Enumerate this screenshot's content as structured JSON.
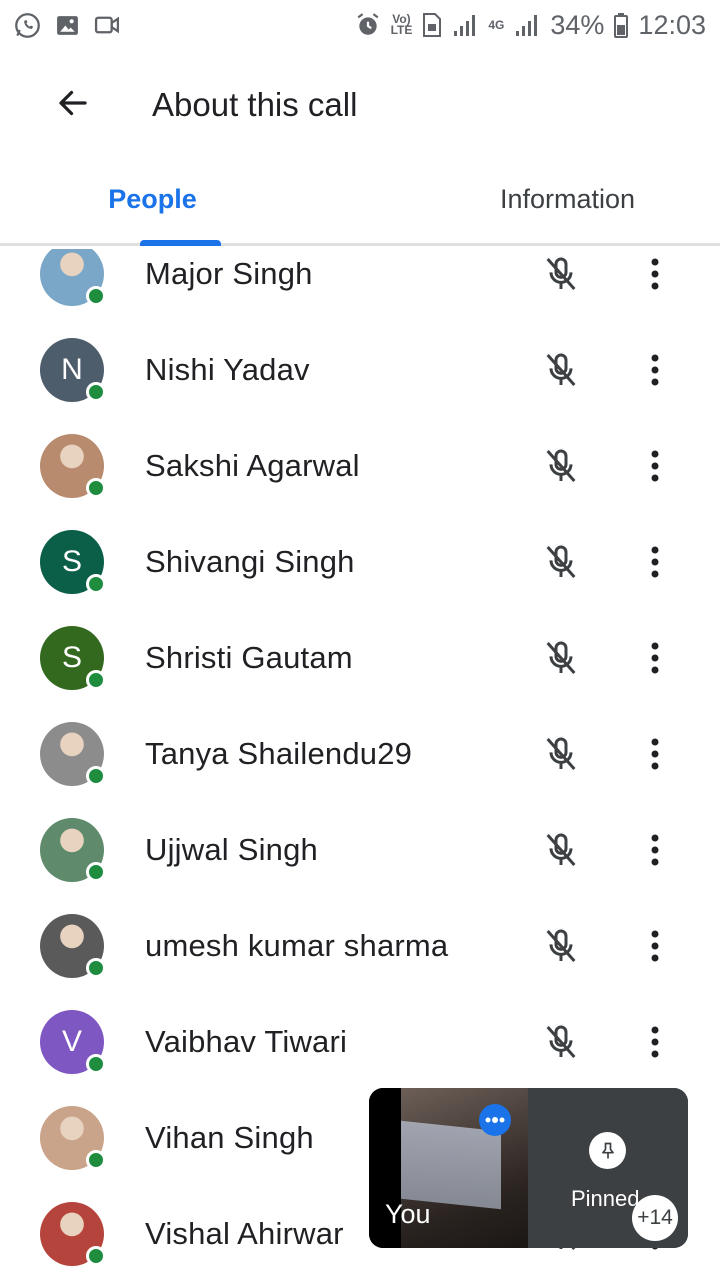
{
  "status_bar": {
    "battery": "34%",
    "time": "12:03",
    "network_top": "Vo)",
    "network_bottom": "LTE",
    "net_type": "4G"
  },
  "header": {
    "title": "About this call"
  },
  "tabs": [
    {
      "label": "People",
      "active": true
    },
    {
      "label": "Information",
      "active": false
    }
  ],
  "participants": [
    {
      "name": "Major Singh",
      "avatar_type": "photo",
      "avatar_color": "#7aa7c7"
    },
    {
      "name": "Nishi Yadav",
      "avatar_type": "letter",
      "initial": "N",
      "avatar_color": "#4e5d6c"
    },
    {
      "name": "Sakshi Agarwal",
      "avatar_type": "photo",
      "avatar_color": "#b88a6e"
    },
    {
      "name": "Shivangi Singh",
      "avatar_type": "letter",
      "initial": "S",
      "avatar_color": "#0b5e47"
    },
    {
      "name": "Shristi Gautam",
      "avatar_type": "letter",
      "initial": "S",
      "avatar_color": "#33691e"
    },
    {
      "name": "Tanya Shailendu29",
      "avatar_type": "photo",
      "avatar_color": "#8c8c8c"
    },
    {
      "name": "Ujjwal Singh",
      "avatar_type": "photo",
      "avatar_color": "#5f8a6b"
    },
    {
      "name": "umesh kumar sharma",
      "avatar_type": "photo",
      "avatar_color": "#5a5a5a"
    },
    {
      "name": "Vaibhav Tiwari",
      "avatar_type": "letter",
      "initial": "V",
      "avatar_color": "#7e57c2"
    },
    {
      "name": "Vihan Singh",
      "avatar_type": "photo",
      "avatar_color": "#c9a38a"
    },
    {
      "name": "Vishal Ahirwar",
      "avatar_type": "photo",
      "avatar_color": "#b5453c"
    }
  ],
  "pip": {
    "self_label": "You",
    "pinned_label": "Pinned",
    "more_count": "+14"
  },
  "colors": {
    "accent": "#1a73e8",
    "presence": "#1e8e3e",
    "icon": "#3c4043"
  }
}
